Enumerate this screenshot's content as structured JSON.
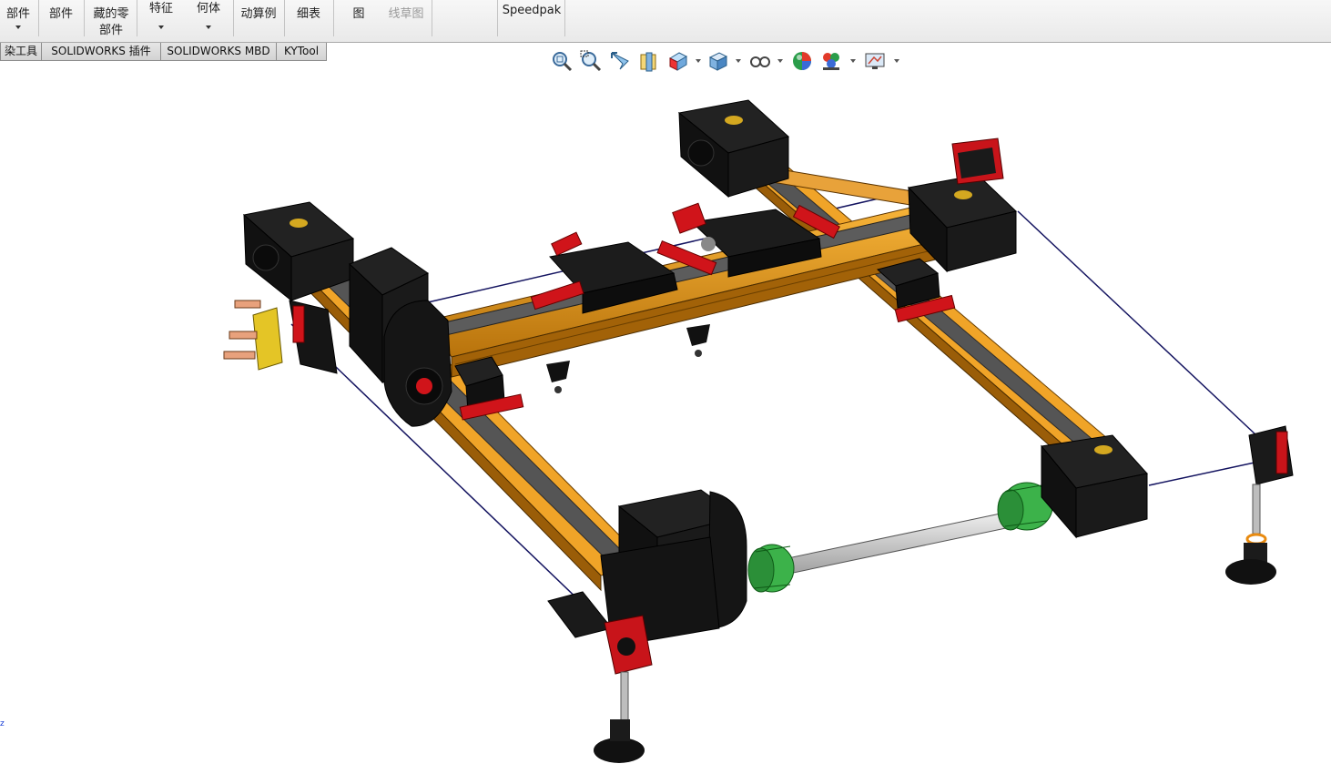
{
  "ribbon": {
    "items": [
      {
        "line1": "部件",
        "line2": "",
        "dropdown": true,
        "disabled": false
      },
      {
        "line1": "部件",
        "line2": "",
        "dropdown": false,
        "disabled": false
      },
      {
        "line1": "藏的零",
        "line2": "部件",
        "dropdown": false,
        "disabled": false
      },
      {
        "line1": "特征",
        "line2": "",
        "dropdown": true,
        "disabled": false
      },
      {
        "line1": "何体",
        "line2": "",
        "dropdown": true,
        "disabled": false
      },
      {
        "line1": "动算例",
        "line2": "",
        "dropdown": false,
        "disabled": false
      },
      {
        "line1": "细表",
        "line2": "",
        "dropdown": false,
        "disabled": false
      },
      {
        "line1": "图",
        "line2": "",
        "dropdown": false,
        "disabled": false
      },
      {
        "line1": "线草图",
        "line2": "",
        "dropdown": false,
        "disabled": true
      },
      {
        "line1": "Speedpak",
        "line2": "",
        "dropdown": false,
        "disabled": false
      }
    ]
  },
  "tabs": [
    {
      "label": "染工具"
    },
    {
      "label": "SOLIDWORKS 插件"
    },
    {
      "label": "SOLIDWORKS MBD"
    },
    {
      "label": "KYTool"
    }
  ],
  "view_toolbar": {
    "icons": [
      "zoom-to-fit-icon",
      "zoom-to-area-icon",
      "previous-view-icon",
      "section-view-icon",
      "view-orientation-icon",
      "display-style-icon",
      "hide-show-items-icon",
      "edit-appearance-icon",
      "apply-scene-icon",
      "view-settings-icon"
    ]
  },
  "model": {
    "name": "laser-gantry-assembly",
    "colors": {
      "rail": "#e0961a",
      "rail_dark": "#9a5d08",
      "motor": "#141414",
      "bracket": "#d0141a",
      "coupling": "#3cb24a",
      "shaft": "#d4d4d4",
      "belt": "#5f5f5f"
    }
  },
  "triad": {
    "label": "z"
  }
}
